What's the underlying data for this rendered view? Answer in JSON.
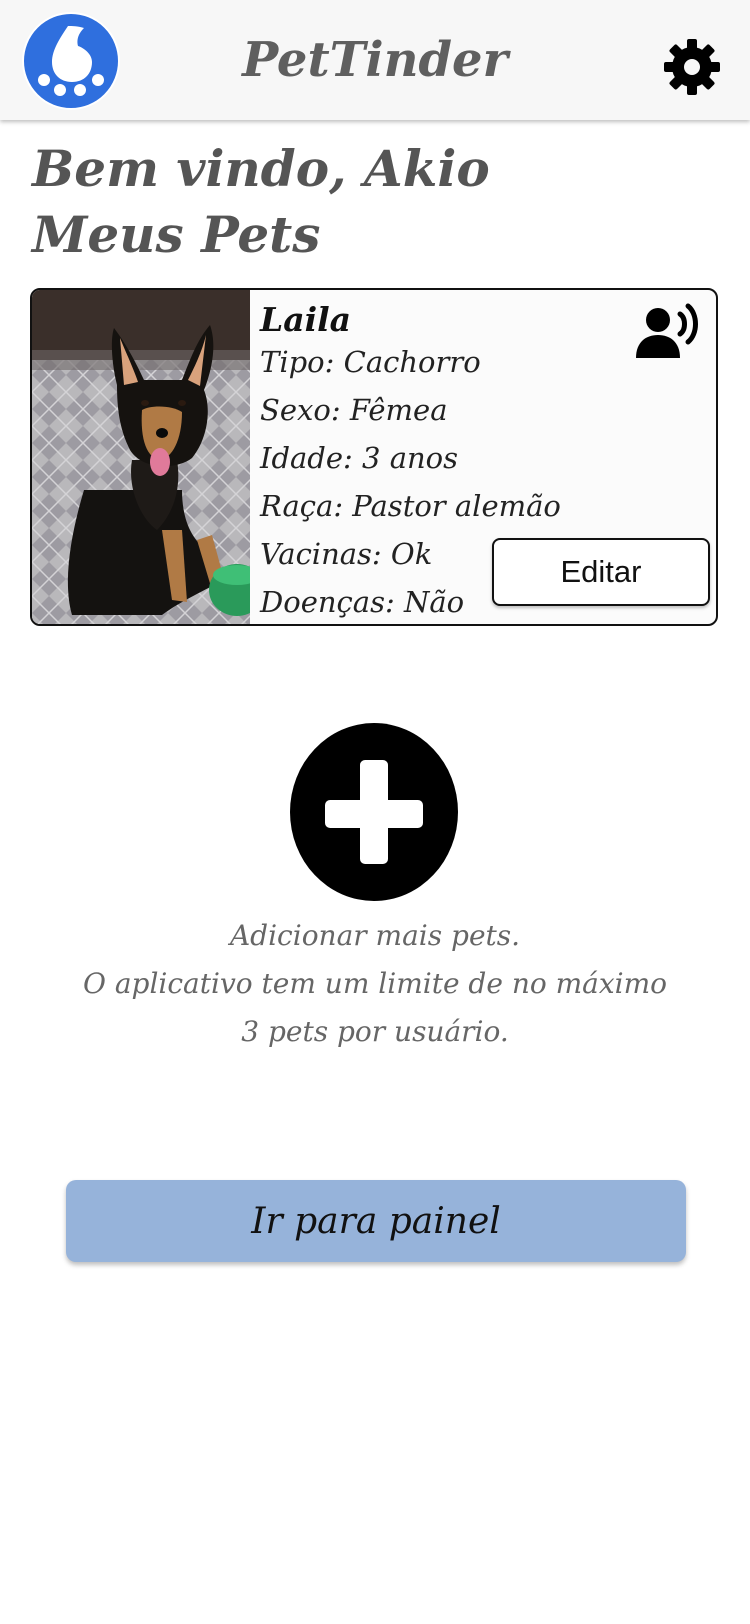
{
  "header": {
    "app_title": "PetTinder",
    "logo_icon": "paw-logo-icon",
    "settings_icon": "gear-icon"
  },
  "welcome": {
    "greeting": "Bem vindo, Akio",
    "section_title": "Meus Pets"
  },
  "pets": [
    {
      "name": "Laila",
      "details": [
        "Tipo: Cachorro",
        "Sexo: Fêmea",
        "Idade: 3 anos",
        "Raça: Pastor alemão",
        "Vacinas: Ok",
        "Doenças: Não"
      ],
      "edit_label": "Editar",
      "voice_icon": "person-voice-icon",
      "photo": "dog-photo"
    }
  ],
  "add_pet": {
    "icon": "plus-circle-icon",
    "line1": "Adicionar mais pets.",
    "line2": "O aplicativo tem um limite de no máximo",
    "line3": "3 pets por usuário."
  },
  "panel_button_label": "Ir para painel",
  "colors": {
    "header_bg": "#f7f7f7",
    "logo_blue": "#2f6fde",
    "panel_button": "#96b3da"
  }
}
